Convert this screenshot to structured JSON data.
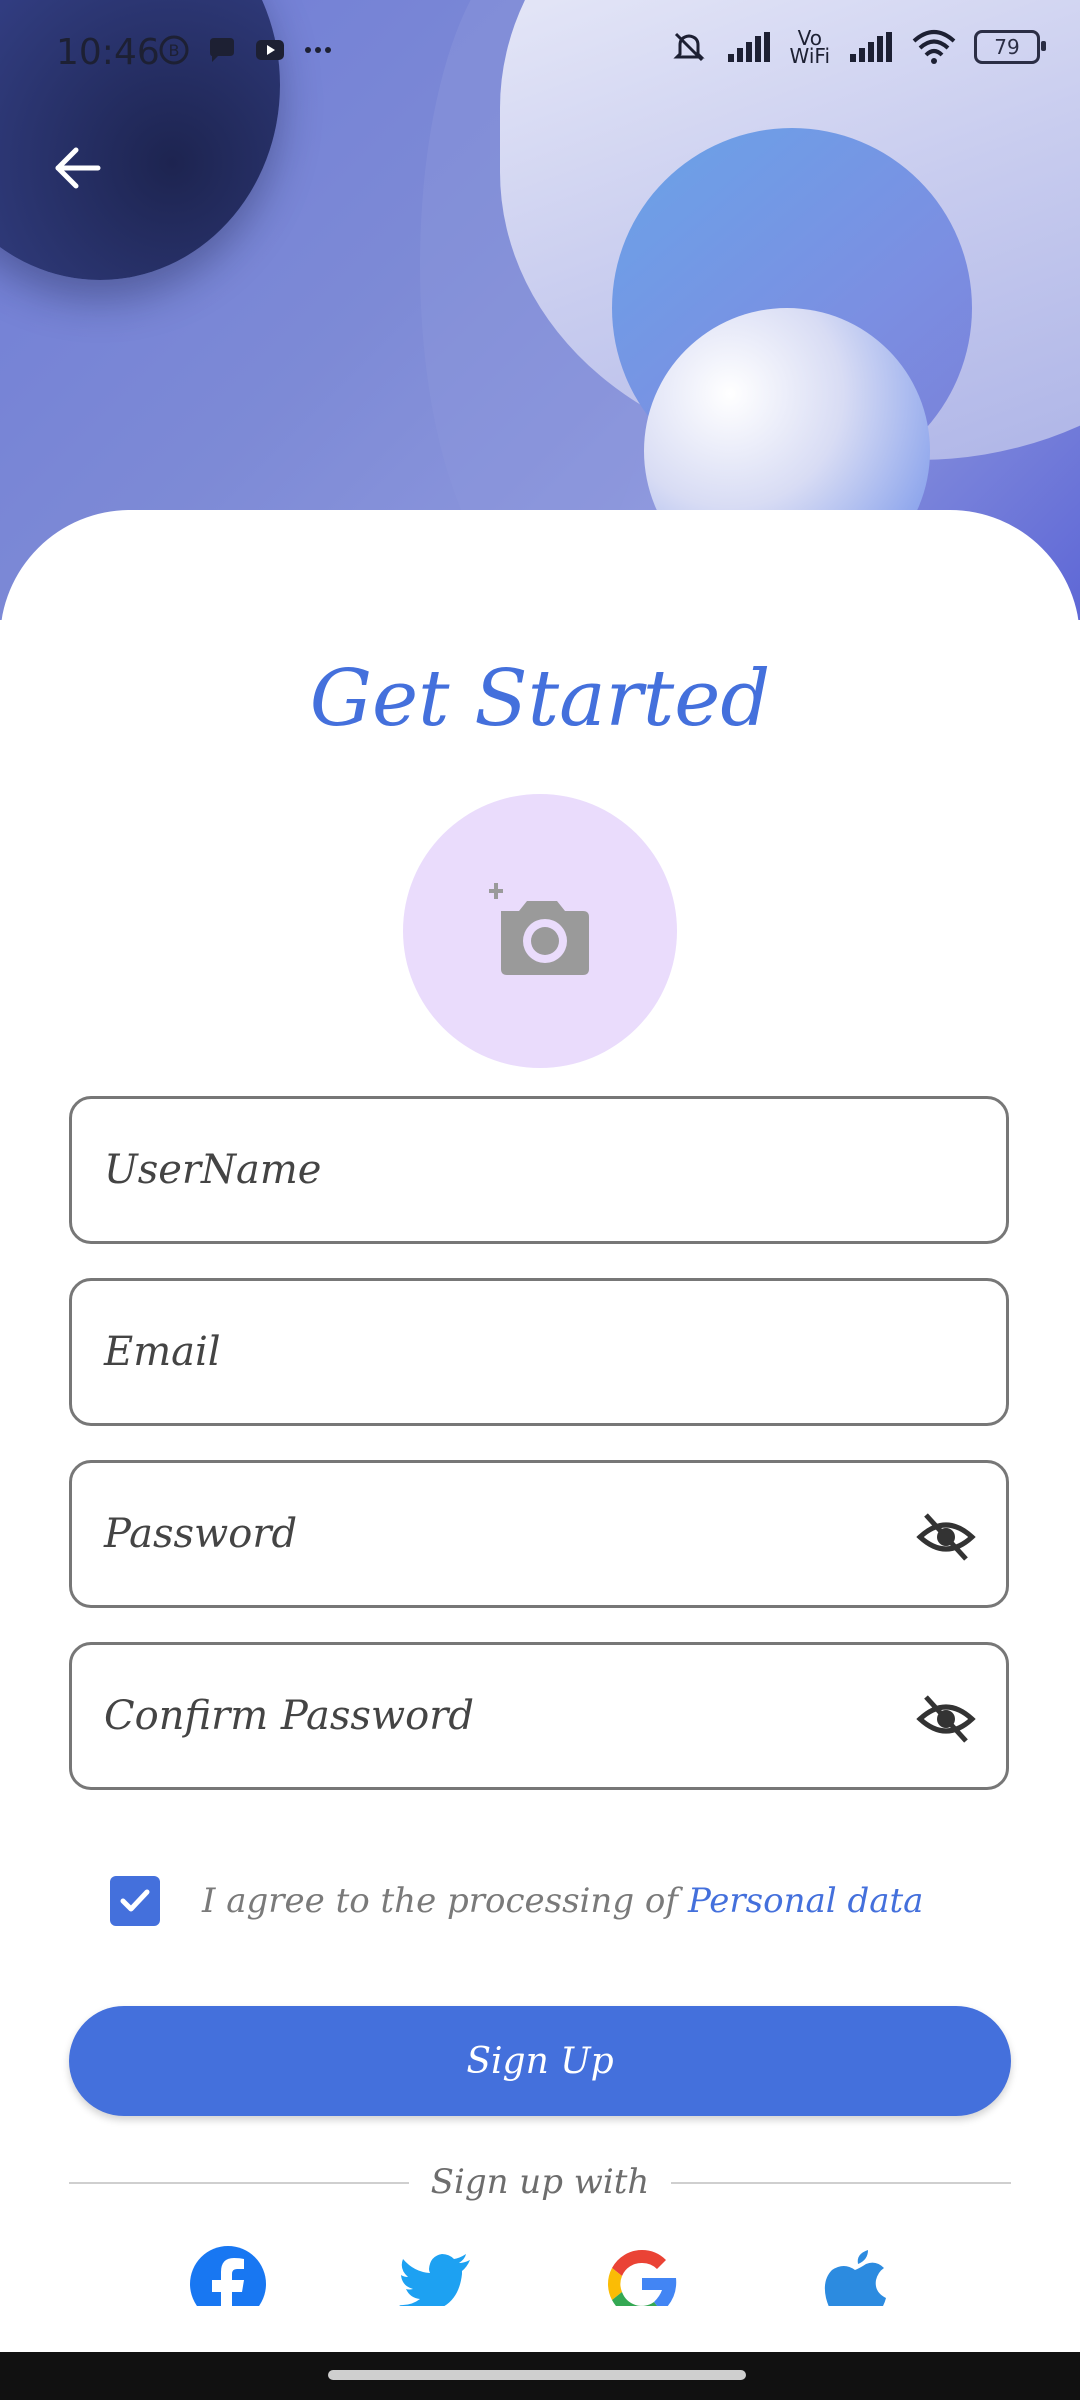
{
  "status_bar": {
    "time": "10:46",
    "battery": "79",
    "icons": [
      "b-icon",
      "chat-icon",
      "youtube-icon",
      "more-icon",
      "mute-bell-icon",
      "signal-icon",
      "vowifi-icon",
      "signal-icon",
      "wifi-icon",
      "battery-icon"
    ],
    "vowifi_top": "Vo",
    "vowifi_bottom": "WiFi"
  },
  "header": {
    "back_icon": "arrow-left-icon"
  },
  "form": {
    "title": "Get Started",
    "photo_icon": "add-camera-icon",
    "username_placeholder": "UserName",
    "email_placeholder": "Email",
    "password_placeholder": "Password",
    "confirm_password_placeholder": "Confirm Password",
    "agree_text": "I agree to the processing of",
    "agree_link": "Personal data",
    "agree_checked": true,
    "signup_label": "Sign Up",
    "signup_with": "Sign up with"
  },
  "social": [
    "facebook-icon",
    "twitter-icon",
    "google-icon",
    "apple-icon"
  ],
  "colors": {
    "accent": "#4470dc",
    "avatar_bg": "#eadcfc"
  }
}
